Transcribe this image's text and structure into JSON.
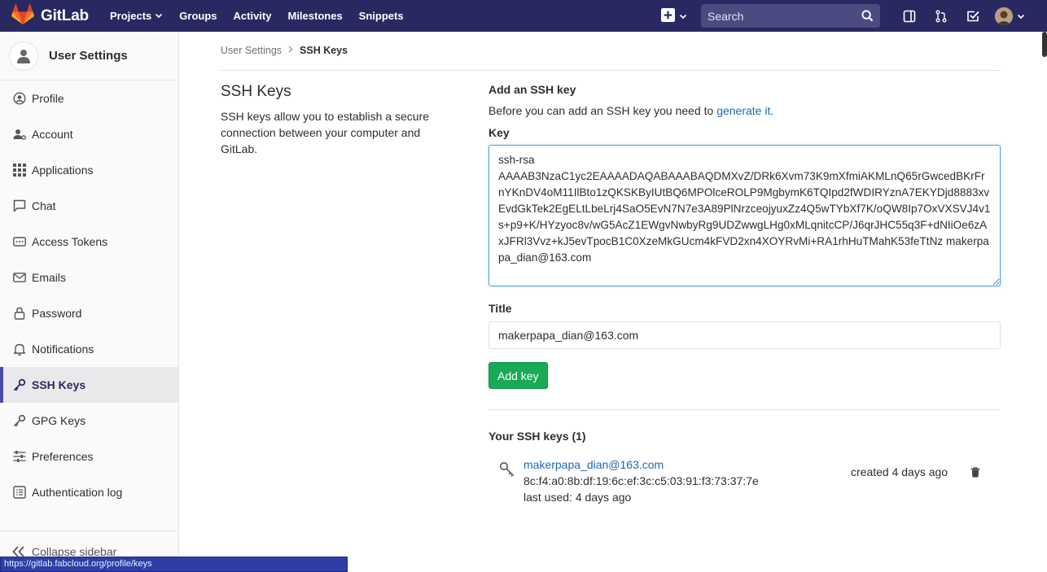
{
  "navbar": {
    "brand": "GitLab",
    "links": [
      {
        "label": "Projects",
        "has_dropdown": true
      },
      {
        "label": "Groups",
        "has_dropdown": false
      },
      {
        "label": "Activity",
        "has_dropdown": false
      },
      {
        "label": "Milestones",
        "has_dropdown": false
      },
      {
        "label": "Snippets",
        "has_dropdown": false
      }
    ],
    "search_placeholder": "Search",
    "icons": [
      "plus-square-icon",
      "search-icon",
      "sidebar-panel-icon",
      "merge-request-icon",
      "todo-check-icon",
      "user-avatar"
    ]
  },
  "sidebar": {
    "title": "User Settings",
    "items": [
      {
        "label": "Profile",
        "icon": "profile-icon"
      },
      {
        "label": "Account",
        "icon": "account-icon"
      },
      {
        "label": "Applications",
        "icon": "applications-grid-icon"
      },
      {
        "label": "Chat",
        "icon": "chat-icon"
      },
      {
        "label": "Access Tokens",
        "icon": "token-icon"
      },
      {
        "label": "Emails",
        "icon": "envelope-icon"
      },
      {
        "label": "Password",
        "icon": "lock-icon"
      },
      {
        "label": "Notifications",
        "icon": "bell-icon"
      },
      {
        "label": "SSH Keys",
        "icon": "key-icon",
        "active": true
      },
      {
        "label": "GPG Keys",
        "icon": "key-icon"
      },
      {
        "label": "Preferences",
        "icon": "sliders-icon"
      },
      {
        "label": "Authentication log",
        "icon": "log-list-icon"
      }
    ],
    "collapse_label": "Collapse sidebar"
  },
  "breadcrumb": {
    "parent": "User Settings",
    "current": "SSH Keys"
  },
  "intro": {
    "title": "SSH Keys",
    "description": "SSH keys allow you to establish a secure connection between your computer and GitLab."
  },
  "form": {
    "heading": "Add an SSH key",
    "description_prefix": "Before you can add an SSH key you need to ",
    "description_link": "generate it.",
    "key_label": "Key",
    "key_value": "ssh-rsa\nAAAAB3NzaC1yc2EAAAADAQABAAABAQDMXvZ/DRk6Xvm73K9mXfmiAKMLnQ65rGwcedBKrFrnYKnDV4oM11IlBto1zQKSKByIUtBQ6MPOlceROLP9MgbymK6TQIpd2fWDIRYznA7EKYDjd8883xvEvdGkTek2EgELtLbeLrj4SaO5EvN7N7e3A89PlNrzceojyuxZz4Q5wTYbXf7K/oQW8Ip7OxVXSVJ4v1s+p9+K/HYzyoc8v/wG5AcZ1EWgvNwbyRg9UDZwwgLHg0xMLqnitcCP/J6qrJHC55q3F+dNIiOe6zAxJFRl3Vvz+kJ5evTpocB1C0XzeMkGUcm4kFVD2xn4XOYRvMi+RA1rhHuTMahK53feTtNz makerpapa_dian@163.com",
    "title_label": "Title",
    "title_value": "makerpapa_dian@163.com",
    "submit_label": "Add key"
  },
  "keys_section": {
    "heading": "Your SSH keys (1)",
    "keys": [
      {
        "title": "makerpapa_dian@163.com",
        "fingerprint": "8c:f4:a0:8b:df:19:6c:ef:3c:c5:03:91:f3:73:37:7e",
        "last_used": "last used: 4 days ago",
        "created": "created 4 days ago"
      }
    ]
  },
  "status_bar": {
    "url": "https://gitlab.fabcloud.org/profile/keys"
  },
  "colors": {
    "navbar": "#292961",
    "accent_link": "#1b69b6",
    "success_button": "#1aaa55",
    "active_indicator": "#4b4ba3"
  }
}
